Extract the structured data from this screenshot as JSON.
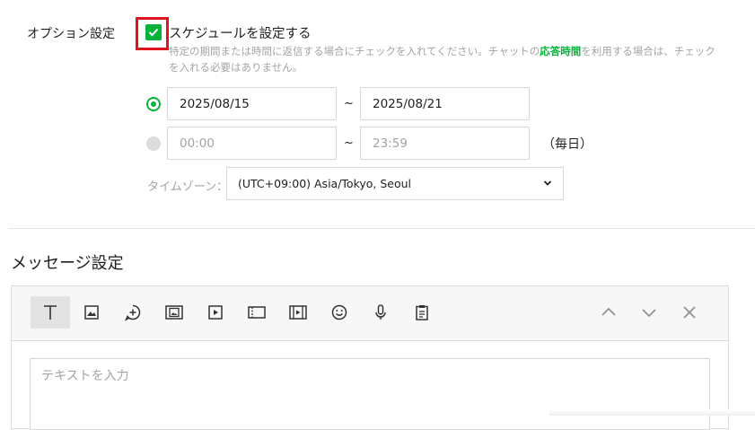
{
  "option": {
    "label": "オプション設定",
    "schedule_label": "スケジュールを設定する",
    "schedule_checked": true,
    "help_part1": "特定の期間または時間に返信する場合にチェックを入れてください。チャットの",
    "help_link": "応答時間",
    "help_part2": "を利用する場合は、チェックを入れる必要はありません。"
  },
  "date_range": {
    "start": "2025/08/15",
    "end": "2025/08/21",
    "separator": "~"
  },
  "time_range": {
    "start": "00:00",
    "end": "23:59",
    "separator": "~",
    "suffix": "（毎日）"
  },
  "timezone": {
    "label": "タイムゾーン：",
    "value": "(UTC+09:00) Asia/Tokyo, Seoul"
  },
  "message": {
    "title": "メッセージ設定",
    "textarea_placeholder": "テキストを入力",
    "toolbar": [
      {
        "name": "text-tool",
        "icon": "text-icon"
      },
      {
        "name": "image-tool",
        "icon": "image-icon"
      },
      {
        "name": "stamp-tool",
        "icon": "chat-bubble-plus-icon"
      },
      {
        "name": "card-tool",
        "icon": "card-image-icon"
      },
      {
        "name": "video-tool",
        "icon": "play-icon"
      },
      {
        "name": "coupon-tool",
        "icon": "coupon-icon"
      },
      {
        "name": "richvideo-tool",
        "icon": "film-icon"
      },
      {
        "name": "emoji-tool",
        "icon": "smiley-icon"
      },
      {
        "name": "audio-tool",
        "icon": "microphone-icon"
      },
      {
        "name": "clipboard-tool",
        "icon": "clipboard-icon"
      }
    ]
  },
  "colors": {
    "accent": "#06b33a",
    "highlight": "#e0141e",
    "muted": "#a4a4a4"
  }
}
